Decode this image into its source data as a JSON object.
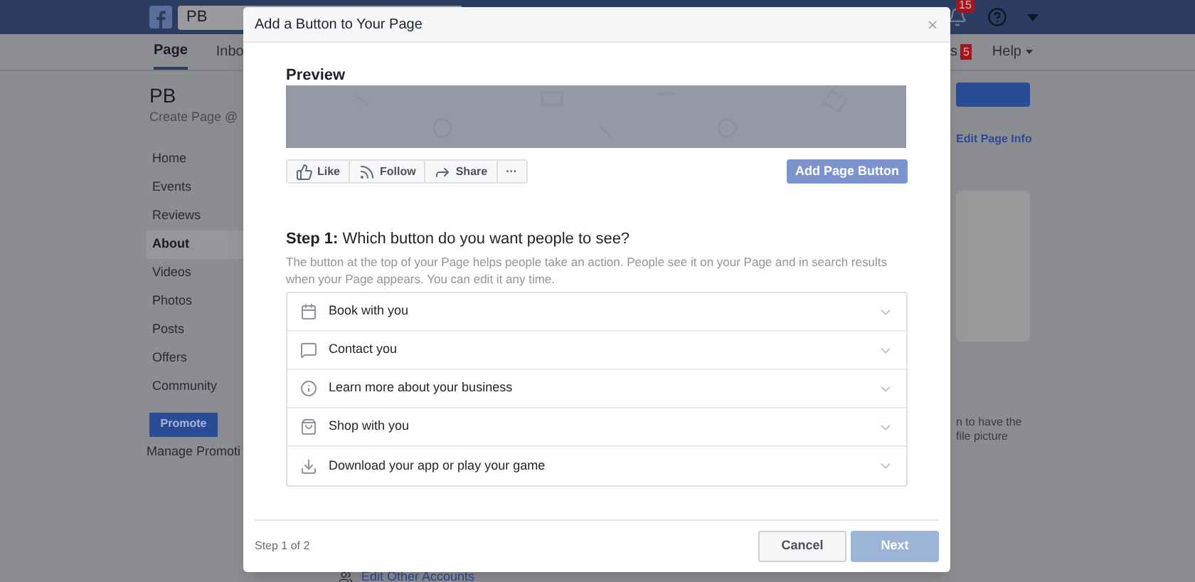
{
  "top_bar": {
    "search_value": "PB",
    "notification_count": "15"
  },
  "page_nav": {
    "tabs": [
      {
        "label": "Page",
        "selected": true
      },
      {
        "label": "Inbo",
        "selected": false
      }
    ],
    "notifications_tab": "s",
    "notifications_badge": "5",
    "help": "Help"
  },
  "page_header": {
    "name": "PB",
    "handle": "Create Page @"
  },
  "sidebar": {
    "items": [
      {
        "label": "Home",
        "selected": false
      },
      {
        "label": "Events",
        "selected": false
      },
      {
        "label": "Reviews",
        "selected": false
      },
      {
        "label": "About",
        "selected": true
      },
      {
        "label": "Videos",
        "selected": false
      },
      {
        "label": "Photos",
        "selected": false
      },
      {
        "label": "Posts",
        "selected": false
      },
      {
        "label": "Offers",
        "selected": false
      },
      {
        "label": "Community",
        "selected": false
      }
    ],
    "promote": "Promote",
    "manage": "Manage Promoti"
  },
  "right_panel": {
    "edit_link": "Edit Page Info",
    "hint_lines": [
      "n to have the",
      "file picture"
    ]
  },
  "footer_link": "Edit Other Accounts",
  "dialog": {
    "title": "Add a Button to Your Page",
    "preview_heading": "Preview",
    "preview_actions": [
      {
        "kind": "like",
        "label": "Like"
      },
      {
        "kind": "follow",
        "label": "Follow"
      },
      {
        "kind": "share",
        "label": "Share"
      },
      {
        "kind": "more",
        "label": "···"
      }
    ],
    "add_button": "Add Page Button",
    "step_label": "Step 1:",
    "step_question": "Which button do you want people to see?",
    "description": "The button at the top of your Page helps people take an action. People see it on your Page and in search results when your Page appears. You can edit it any time.",
    "options": [
      {
        "kind": "calendar",
        "label": "Book with you",
        "expanded": false
      },
      {
        "kind": "chat",
        "label": "Contact you",
        "expanded": false
      },
      {
        "kind": "info",
        "label": "Learn more about your business",
        "expanded": false
      },
      {
        "kind": "shop",
        "label": "Shop with you",
        "expanded": false
      },
      {
        "kind": "download",
        "label": "Download your app or play your game",
        "expanded": false
      }
    ],
    "step_count": "Step 1 of 2",
    "cancel": "Cancel",
    "next": {
      "label": "Next",
      "disabled": true
    }
  }
}
